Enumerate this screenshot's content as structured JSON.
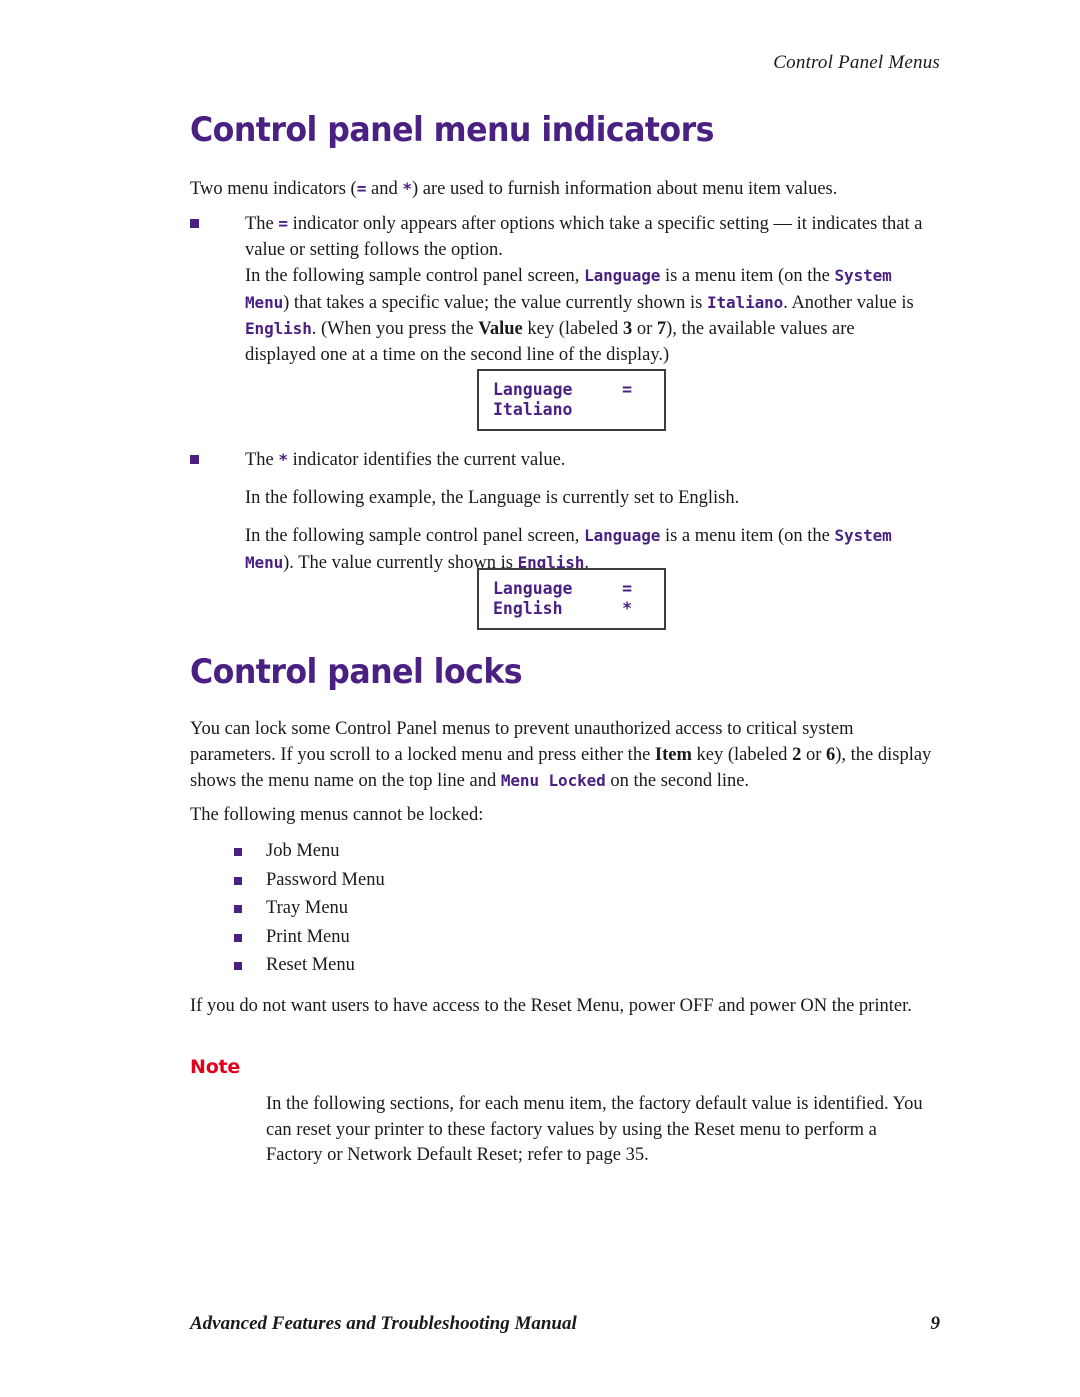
{
  "header": {
    "running_head": "Control Panel Menus"
  },
  "sections": {
    "indicators": {
      "title": "Control panel menu indicators",
      "intro_a": "Two menu indicators (",
      "intro_eq": "=",
      "intro_b": " and ",
      "intro_star": "*",
      "intro_c": ") are used to furnish information about menu item values.",
      "bullet1": {
        "a": "The ",
        "eq": "=",
        "b": " indicator only appears after options which take a specific setting — it indicates that a value or setting follows the option.",
        "sub_a": "In the following sample control panel screen, ",
        "sub_mono1": "Language",
        "sub_b": " is a menu item (on the ",
        "sub_mono2": "System Menu",
        "sub_c": ") that takes a specific value; the value currently shown is ",
        "sub_mono3": "Italiano",
        "sub_d": ". Another value is ",
        "sub_mono4": "English",
        "sub_e": ". (When you press the ",
        "sub_bold1": "Value",
        "sub_f": " key (labeled ",
        "sub_bold2": "3",
        "sub_g": " or ",
        "sub_bold3": "7",
        "sub_h": "), the available values are displayed one at a time on the second line of the display.)"
      },
      "lcd1": {
        "line1": "Language     =",
        "line2": "Italiano"
      },
      "bullet2": {
        "a": "The ",
        "star": "*",
        "b": " indicator identifies the current value.",
        "sub1": "In the following example, the Language is currently set to English.",
        "sub2_a": "In the following sample control panel screen, ",
        "sub2_mono1": "Language",
        "sub2_b": " is a menu item (on the ",
        "sub2_mono2": "System Menu",
        "sub2_c": "). The value currently shown is ",
        "sub2_mono3": "English",
        "sub2_d": "."
      },
      "lcd2": {
        "line1": "Language     =",
        "line2": "English      *"
      }
    },
    "locks": {
      "title": "Control panel locks",
      "para_a": "You can lock some Control Panel menus to prevent unauthorized access to critical system parameters. If you scroll to a locked menu and press either the ",
      "para_bold1": "Item",
      "para_b": " key (labeled ",
      "para_bold2": "2",
      "para_c": " or ",
      "para_bold3": "6",
      "para_d": "), the display shows the menu name on the top line and ",
      "para_mono1": "Menu Locked",
      "para_e": " on the second line.",
      "intro": "The following menus cannot be locked:",
      "menus": [
        "Job Menu",
        "Password Menu",
        "Tray Menu",
        "Print Menu",
        "Reset Menu"
      ],
      "power_para": "If you do not want users to have access to the Reset Menu, power OFF and power ON the printer.",
      "note_label": "Note",
      "note_body": "In the following sections, for each menu item, the factory default value is identified. You can reset your printer to these factory values by using the Reset menu to perform a Factory or Network Default Reset; refer to page 35."
    }
  },
  "footer": {
    "manual_title": "Advanced Features and Troubleshooting Manual",
    "page_number": "9"
  },
  "colors": {
    "heading_purple": "#4A2183",
    "note_red": "#E3001B",
    "body_black": "#1a1a1a",
    "lcd_border": "#3d3d3d"
  }
}
